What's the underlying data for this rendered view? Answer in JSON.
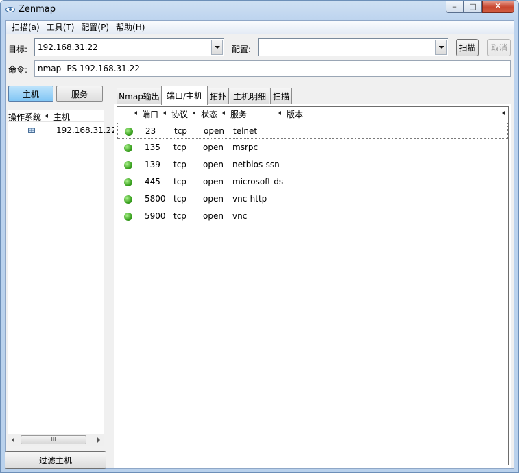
{
  "window": {
    "title": "Zenmap"
  },
  "menu": [
    "扫描(a)",
    "工具(T)",
    "配置(P)",
    "帮助(H)"
  ],
  "target": {
    "label": "目标:",
    "value": "192.168.31.22"
  },
  "profile": {
    "label": "配置:",
    "value": ""
  },
  "buttons": {
    "scan": "扫描",
    "cancel": "取消"
  },
  "command": {
    "label": "命令:",
    "value": "nmap -PS 192.168.31.22"
  },
  "left_pane": {
    "toggle_hosts": "主机",
    "toggle_services": "服务",
    "columns": {
      "os": "操作系统",
      "host": "主机"
    },
    "hosts": [
      {
        "os_icon": "windows-os-icon",
        "ip": "192.168.31.22"
      }
    ],
    "scroll_thumb": "III",
    "filter_button": "过滤主机"
  },
  "tabs": [
    "Nmap输出",
    "端口/主机",
    "拓扑",
    "主机明细",
    "扫描"
  ],
  "ports_table": {
    "columns": [
      "端口",
      "协议",
      "状态",
      "服务",
      "版本"
    ],
    "status_color": "#3aa11f",
    "rows": [
      {
        "port": "23",
        "protocol": "tcp",
        "state": "open",
        "service": "telnet",
        "version": ""
      },
      {
        "port": "135",
        "protocol": "tcp",
        "state": "open",
        "service": "msrpc",
        "version": ""
      },
      {
        "port": "139",
        "protocol": "tcp",
        "state": "open",
        "service": "netbios-ssn",
        "version": ""
      },
      {
        "port": "445",
        "protocol": "tcp",
        "state": "open",
        "service": "microsoft-ds",
        "version": ""
      },
      {
        "port": "5800",
        "protocol": "tcp",
        "state": "open",
        "service": "vnc-http",
        "version": ""
      },
      {
        "port": "5900",
        "protocol": "tcp",
        "state": "open",
        "service": "vnc",
        "version": ""
      }
    ]
  }
}
